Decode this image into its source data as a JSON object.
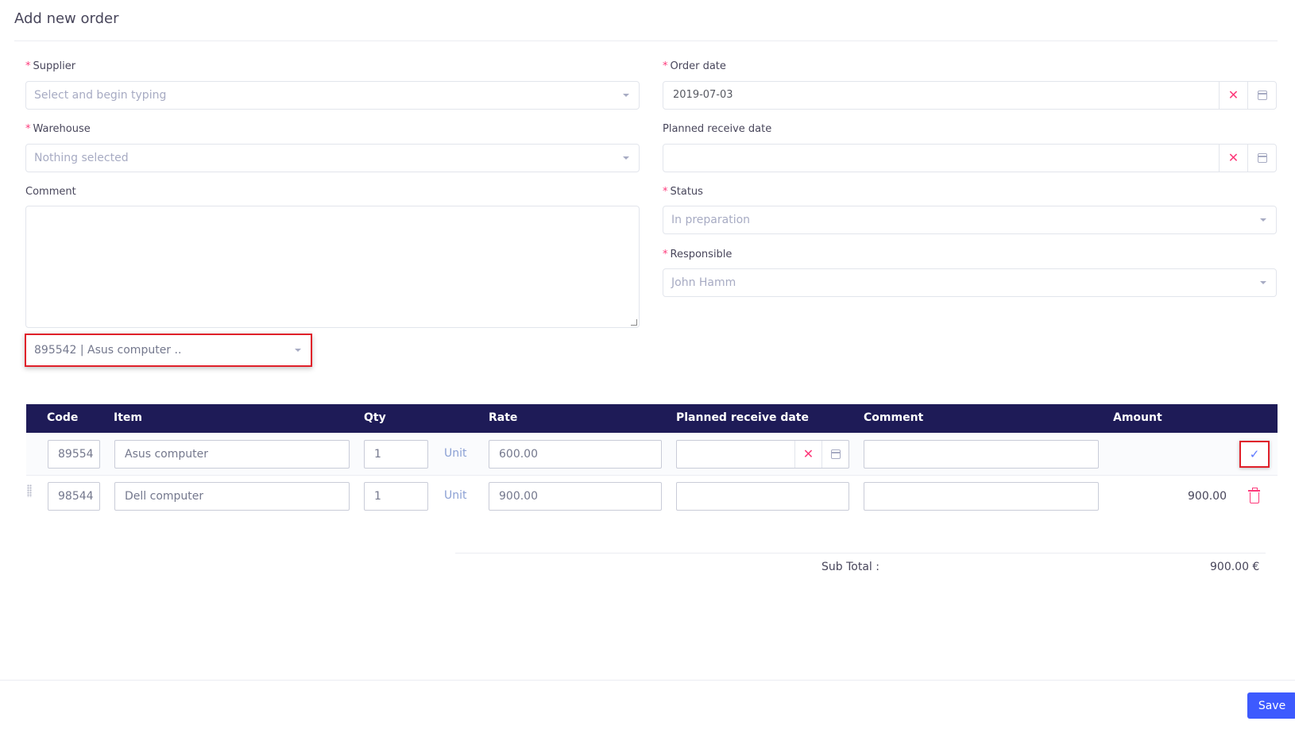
{
  "page": {
    "title": "Add new order"
  },
  "form": {
    "supplier": {
      "label": "Supplier",
      "placeholder": "Select and begin typing"
    },
    "warehouse": {
      "label": "Warehouse",
      "placeholder": "Nothing selected"
    },
    "comment": {
      "label": "Comment",
      "value": ""
    },
    "order_date": {
      "label": "Order date",
      "value": "2019-07-03"
    },
    "planned_receive_date": {
      "label": "Planned receive date",
      "value": ""
    },
    "status": {
      "label": "Status",
      "value": "In preparation"
    },
    "responsible": {
      "label": "Responsible",
      "value": "John Hamm"
    },
    "required_mark": "*"
  },
  "item_picker": {
    "value": "895542 | Asus computer .."
  },
  "table": {
    "headers": {
      "code": "Code",
      "item": "Item",
      "qty": "Qty",
      "rate": "Rate",
      "planned_receive_date": "Planned receive date",
      "comment": "Comment",
      "amount": "Amount"
    },
    "rows": [
      {
        "code": "89554",
        "item": "Asus computer",
        "qty": "1",
        "unit": "Unit",
        "rate": "600.00",
        "planned_receive_date": "",
        "comment": "",
        "amount": ""
      },
      {
        "code": "98544",
        "item": "Dell computer",
        "qty": "1",
        "unit": "Unit",
        "rate": "900.00",
        "planned_receive_date": "",
        "comment": "",
        "amount": "900.00"
      }
    ]
  },
  "summary": {
    "subtotal_label": "Sub Total :",
    "subtotal_value": "900.00 €"
  },
  "actions": {
    "save_label": "Save"
  },
  "icons": {
    "clear": "close-icon",
    "calendar": "calendar-icon",
    "confirm": "check-icon",
    "delete": "trash-icon",
    "dropdown": "chevron-down-icon",
    "drag": "drag-handle-icon"
  },
  "colors": {
    "accent": "#3d5afe",
    "table_header": "#1e1b57",
    "danger": "#fd397a",
    "highlight_border": "#e0202a"
  }
}
